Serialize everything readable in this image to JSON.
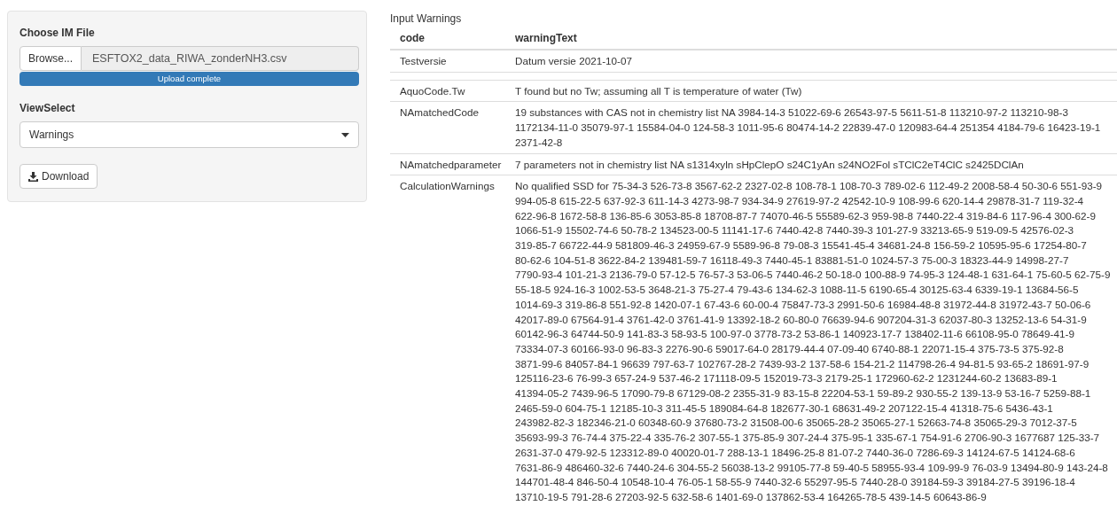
{
  "sidebar": {
    "file_input": {
      "label": "Choose IM File",
      "button": "Browse...",
      "value": "ESFTOX2_data_RIWA_zonderNH3.csv"
    },
    "upload": {
      "level": 1,
      "text": "Upload complete"
    },
    "view_select": {
      "label": "ViewSelect",
      "value": "Warnings"
    },
    "download_button": "Download"
  },
  "table": {
    "title": "Input Warnings",
    "columns": [
      "code",
      "warningText"
    ],
    "rows": [
      {
        "kind": "text",
        "code": "Testversie",
        "text": "Datum versie 2021-10-07"
      },
      {
        "kind": "blank"
      },
      {
        "kind": "text",
        "code": "AquoCode.Tw",
        "text": "T found but no Tw; assuming all T is temperature of water (Tw)"
      },
      {
        "kind": "text",
        "code": "NAmatchedCode",
        "text": "19 substances with CAS not in chemistry list NA 3984-14-3 51022-69-6 26543-97-5 5611-51-8 113210-97-2 113210-98-3 1172134-11-0 35079-97-1 15584-04-0 124-58-3 1011-95-6 80474-14-2 22839-47-0 120983-64-4 251354 4184-79-6 16423-19-1 2371-42-8"
      },
      {
        "kind": "text",
        "code": "NAmatchedparameter",
        "text": "7 parameters not in chemistry list NA s1314xyln sHpClepO s24C1yAn s24NO2Fol sTClC2eT4ClC s2425DClAn"
      },
      {
        "kind": "text",
        "code": "CalculationWarnings",
        "text": "No qualified SSD for 75-34-3 526-73-8 3567-62-2 2327-02-8 108-78-1 108-70-3 789-02-6 112-49-2 2008-58-4 50-30-6 551-93-9 994-05-8 615-22-5 637-92-3 611-14-3 4273-98-7 934-34-9 27619-97-2 42542-10-9 108-99-6 620-14-4 29878-31-7 119-32-4 622-96-8 1672-58-8 136-85-6 3053-85-8 18708-87-7 74070-46-5 55589-62-3 959-98-8 7440-22-4 319-84-6 117-96-4 300-62-9 1066-51-9 15502-74-6 50-78-2 134523-00-5 11141-17-6 7440-42-8 7440-39-3 101-27-9 33213-65-9 519-09-5 42576-02-3 319-85-7 66722-44-9 581809-46-3 24959-67-9 5589-96-8 79-08-3 15541-45-4 34681-24-8 156-59-2 10595-95-6 17254-80-7 80-62-6 104-51-8 3622-84-2 139481-59-7 16118-49-3 7440-45-1 83881-51-0 1024-57-3 75-00-3 18323-44-9 14998-27-7 7790-93-4 101-21-3 2136-79-0 57-12-5 76-57-3 53-06-5 7440-46-2 50-18-0 100-88-9 74-95-3 124-48-1 631-64-1 75-60-5 62-75-9 55-18-5 924-16-3 1002-53-5 3648-21-3 75-27-4 79-43-6 134-62-3 1088-11-5 6190-65-4 30125-63-4 6339-19-1 13684-56-5 1014-69-3 319-86-8 551-92-8 1420-07-1 67-43-6 60-00-4 75847-73-3 2991-50-6 16984-48-8 31972-44-8 31972-43-7 50-06-6 42017-89-0 67564-91-4 3761-42-0 3761-41-9 13392-18-2 60-80-0 76639-94-6 907204-31-3 62037-80-3 13252-13-6 54-31-9 60142-96-3 64744-50-9 141-83-3 58-93-5 100-97-0 3778-73-2 53-86-1 140923-17-7 138402-11-6 66108-95-0 78649-41-9 73334-07-3 60166-93-0 96-83-3 2276-90-6 59017-64-0 28179-44-4 07-09-40 6740-88-1 22071-15-4 375-73-5 375-92-8 3871-99-6 84057-84-1 96639 797-63-7 102767-28-2 7439-93-2 137-58-6 154-21-2 114798-26-4 94-81-5 93-65-2 18691-97-9 125116-23-6 76-99-3 657-24-9 537-46-2 171118-09-5 152019-73-3 2179-25-1 172960-62-2 1231244-60-2 13683-89-1 41394-05-2 7439-96-5 17090-79-8 67129-08-2 2355-31-9 83-15-8 22204-53-1 59-89-2 930-55-2 139-13-9 53-16-7 5259-88-1 2465-59-0 604-75-1 12185-10-3 311-45-5 189084-64-8 182677-30-1 68631-49-2 207122-15-4 41318-75-6 5436-43-1 243982-82-3 182346-21-0 60348-60-9 37680-73-2 31508-00-6 35065-28-2 35065-27-1 52663-74-8 35065-29-3 7012-37-5 35693-99-3 76-74-4 375-22-4 335-76-2 307-55-1 375-85-9 307-24-4 375-95-1 335-67-1 754-91-6 2706-90-3 1677687 125-33-7 2631-37-0 479-92-5 123312-89-0 40020-01-7 288-13-1 18496-25-8 81-07-2 7440-36-0 7286-69-3 14124-67-5 14124-68-6 7631-86-9 486460-32-6 7440-24-6 304-55-2 56038-13-2 99105-77-8 59-40-5 58955-93-4 109-99-9 76-03-9 13494-80-9 143-24-8 144701-48-4 846-50-4 10548-10-4 76-05-1 58-55-9 7440-32-6 55297-95-5 7440-28-0 39184-59-3 39184-27-5 39196-18-4 13710-19-5 791-28-6 27203-92-5 632-58-6 1401-69-0 137862-53-4 164265-78-5 439-14-5 60643-86-9"
      }
    ]
  }
}
